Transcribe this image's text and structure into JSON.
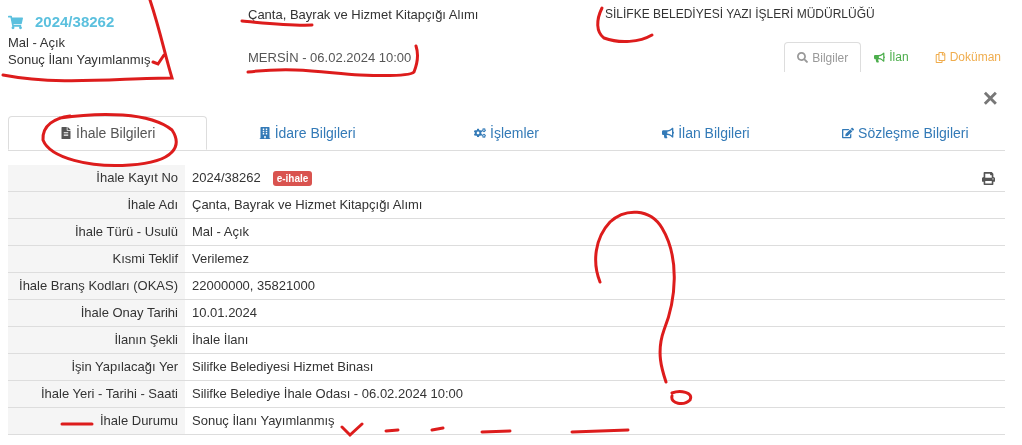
{
  "header": {
    "number": "2024/38262",
    "type": "Mal - Açık",
    "status": "Sonuç İlanı Yayımlanmış",
    "title": "Çanta, Bayrak ve Hizmet Kitapçığı Alımı",
    "place_date": "MERSİN - 06.02.2024 10:00",
    "authority": "SİLİFKE BELEDİYESİ YAZI İŞLERİ MÜDÜRLÜĞÜ"
  },
  "mini_tabs": [
    {
      "label": "Bilgiler",
      "selected": true,
      "color": "#999999"
    },
    {
      "label": "İlan",
      "selected": false,
      "color": "#4cae4c"
    },
    {
      "label": "Doküman",
      "selected": false,
      "color": "#f0ad4e"
    }
  ],
  "close": "×",
  "tabs": [
    {
      "label": "İhale Bilgileri",
      "selected": true
    },
    {
      "label": "İdare Bilgileri",
      "selected": false
    },
    {
      "label": "İşlemler",
      "selected": false
    },
    {
      "label": "İlan Bilgileri",
      "selected": false
    },
    {
      "label": "Sözleşme Bilgileri",
      "selected": false
    }
  ],
  "table": {
    "rows": [
      {
        "label": "İhale Kayıt No",
        "value": "2024/38262",
        "badge": "e-ihale"
      },
      {
        "label": "İhale Adı",
        "value": "Çanta, Bayrak ve Hizmet Kitapçığı Alımı"
      },
      {
        "label": "İhale Türü - Usulü",
        "value": "Mal - Açık"
      },
      {
        "label": "Kısmi Teklif",
        "value": "Verilemez"
      },
      {
        "label": "İhale Branş Kodları (OKAS)",
        "value": "22000000, 35821000"
      },
      {
        "label": "İhale Onay Tarihi",
        "value": "10.01.2024"
      },
      {
        "label": "İlanın Şekli",
        "value": "İhale İlanı"
      },
      {
        "label": "İşin Yapılacağı Yer",
        "value": "Silifke Belediyesi Hizmet Binası"
      },
      {
        "label": "İhale Yeri - Tarihi - Saati",
        "value": "Silifke Belediye İhale Odası - 06.02.2024 10:00"
      },
      {
        "label": "İhale Durumu",
        "value": "Sonuç İlanı Yayımlanmış"
      }
    ]
  }
}
